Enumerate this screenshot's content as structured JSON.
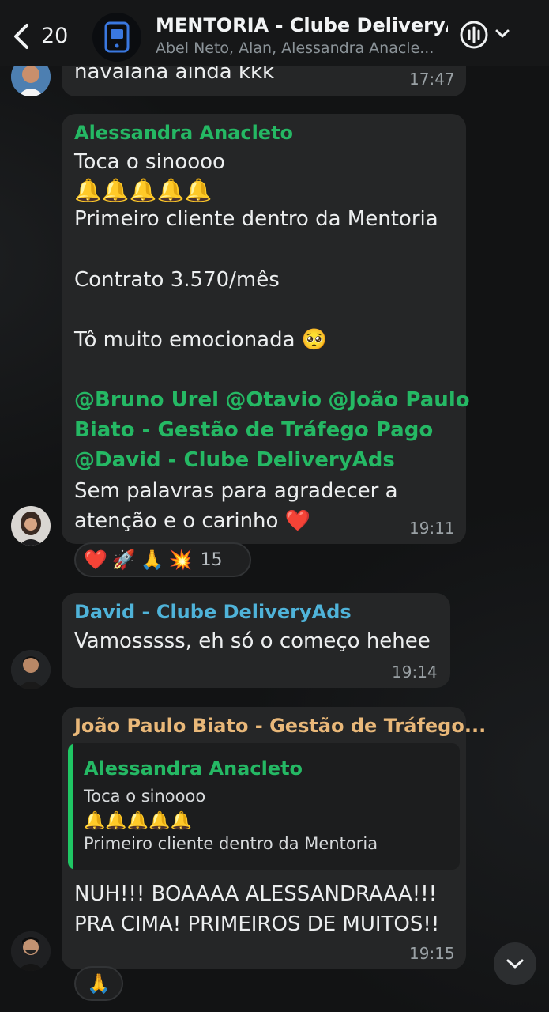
{
  "header": {
    "back_count": "20",
    "title": "MENTORIA - Clube DeliveryA...",
    "subtitle": "Abel Neto, Alan, Alessandra Anacle..."
  },
  "colors": {
    "alessandra": "#25b864",
    "david": "#4fb3d9",
    "joao": "#e9b879",
    "bubble": "#252627",
    "background": "#121314"
  },
  "messages": [
    {
      "id": "prev",
      "text": "navalana ainda kkk",
      "time": "17:47"
    },
    {
      "id": "alessandra",
      "sender": "Alessandra Anacleto",
      "line1": "Toca o sinoooo",
      "bells": "🔔🔔🔔🔔🔔",
      "line2": "Primeiro cliente dentro da Mentoria",
      "line3": "Contrato 3.570/mês",
      "line4": "Tô muito emocionada",
      "line4_emoji": "🥺",
      "mentions": [
        "@Bruno Urel",
        "@Otavio",
        "@João Paulo",
        "Biato - Gestão de Tráfego Pago",
        "@David - Clube DeliveryAds"
      ],
      "line5": "Sem palavras para agradecer a",
      "line6": "atenção e o carinho",
      "line6_emoji": "❤️",
      "time": "19:11",
      "reactions": [
        "❤️",
        "🚀",
        "🙏",
        "💥"
      ],
      "reaction_count": "15"
    },
    {
      "id": "david",
      "sender": "David - Clube DeliveryAds",
      "text": "Vamosssss, eh só o começo hehee",
      "time": "19:14"
    },
    {
      "id": "joao",
      "sender": "João Paulo Biato - Gestão de Tráfego...",
      "quote": {
        "sender": "Alessandra Anacleto",
        "line1": "Toca o sinoooo",
        "bells": "🔔🔔🔔🔔🔔",
        "line2": "Primeiro cliente dentro da Mentoria"
      },
      "line1": "NUH!!! BOAAAA ALESSANDRAAA!!!",
      "line2": "PRA CIMA! PRIMEIROS DE MUITOS!!",
      "time": "19:15",
      "reactions": [
        "🙏"
      ]
    }
  ],
  "icons": {
    "back": "chevron-left-icon",
    "call": "voice-chat-icon",
    "menu": "chevron-down-icon",
    "scroll": "chevron-down-icon"
  }
}
